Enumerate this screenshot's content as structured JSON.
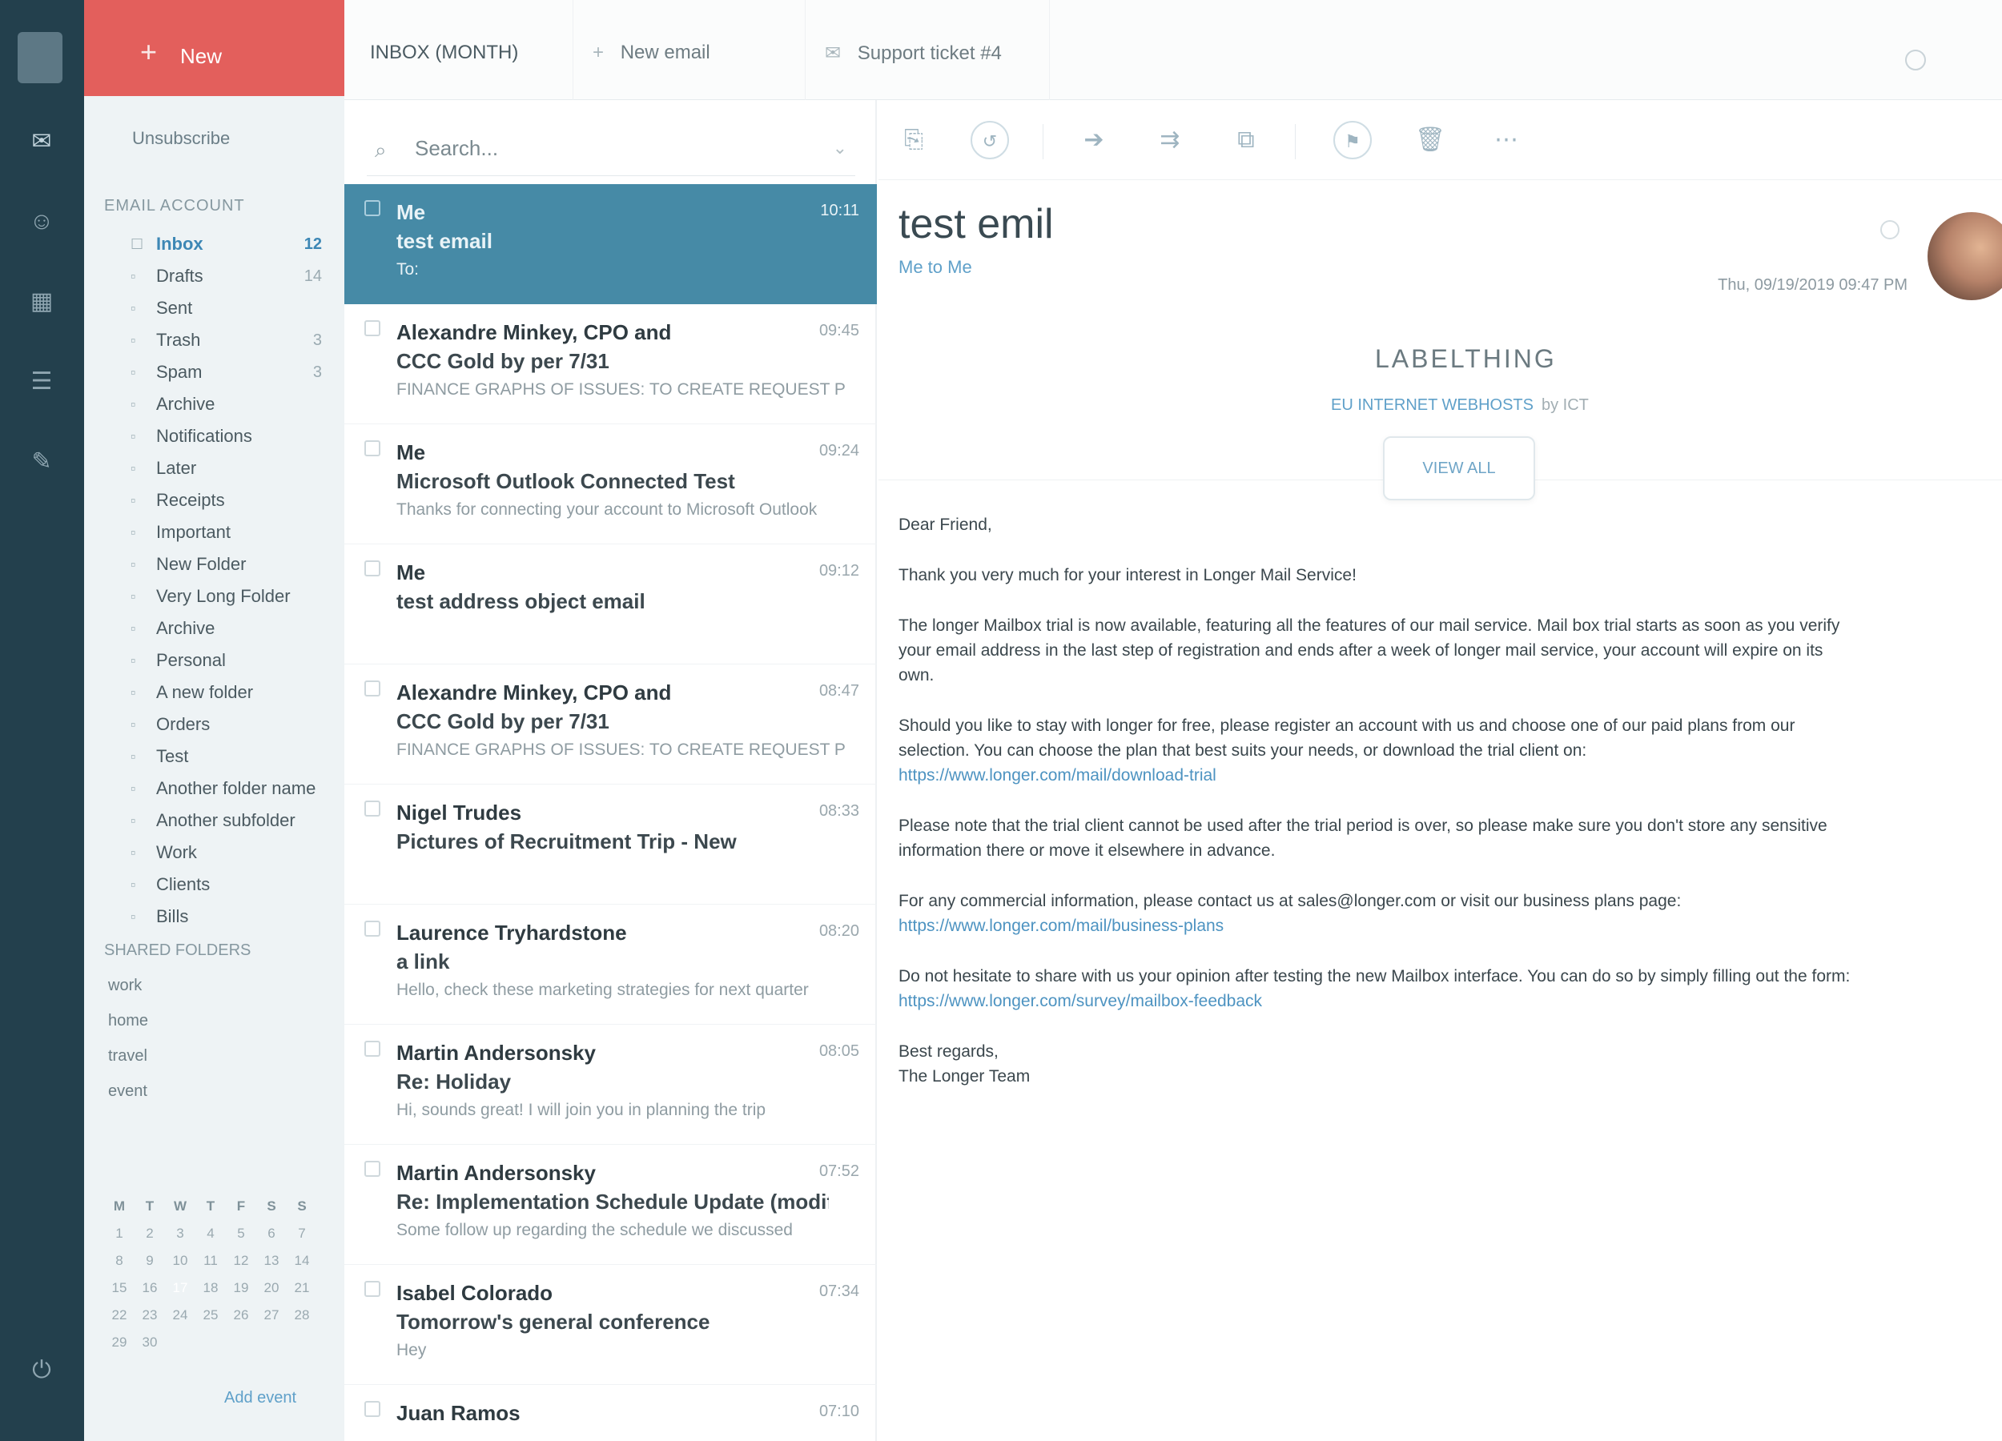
{
  "rail": {
    "icons": [
      "hamburger-icon",
      "mail-icon",
      "contacts-icon",
      "calendar-icon",
      "tasks-icon",
      "chat-icon",
      "logout-icon"
    ]
  },
  "compose": {
    "label": "New"
  },
  "folders_pane": {
    "unsubscribe": "Unsubscribe",
    "account": "EMAIL ACCOUNT",
    "folders": [
      {
        "label": "Inbox",
        "count": "12",
        "type": "inbox"
      },
      {
        "label": "Drafts",
        "count": "14",
        "type": "sub"
      },
      {
        "label": "Sent",
        "count": "",
        "type": "sub"
      },
      {
        "label": "Trash",
        "count": "3",
        "type": "sub"
      },
      {
        "label": "Spam",
        "count": "3",
        "type": "sub"
      },
      {
        "label": "Archive",
        "count": "",
        "type": "sub"
      },
      {
        "label": "Notifications",
        "count": "",
        "type": "sub"
      },
      {
        "label": "Later",
        "count": "",
        "type": "sub"
      },
      {
        "label": "Receipts",
        "count": "",
        "type": "sub"
      },
      {
        "label": "Important",
        "count": "",
        "type": "sub"
      },
      {
        "label": "New Folder",
        "count": "",
        "type": "sub"
      },
      {
        "label": "Very Long Folder",
        "count": "",
        "type": "sub"
      },
      {
        "label": "Archive",
        "count": "",
        "type": "sub"
      },
      {
        "label": "Personal",
        "count": "",
        "type": "sub"
      },
      {
        "label": "A new folder",
        "count": "",
        "type": "sub"
      },
      {
        "label": "Orders",
        "count": "",
        "type": "sub"
      },
      {
        "label": "Test",
        "count": "",
        "type": "sub"
      },
      {
        "label": "Another folder name",
        "count": "",
        "type": "sub"
      },
      {
        "label": "Another subfolder",
        "count": "",
        "type": "sub"
      },
      {
        "label": "Work",
        "count": "",
        "type": "sub"
      },
      {
        "label": "Clients",
        "count": "",
        "type": "sub"
      },
      {
        "label": "Bills",
        "count": "",
        "type": "sub"
      }
    ],
    "labels_title": "SHARED FOLDERS",
    "labels": [
      "work",
      "home",
      "travel",
      "event"
    ]
  },
  "calendar": {
    "weekdays": [
      "M",
      "T",
      "W",
      "T",
      "F",
      "S",
      "S"
    ],
    "weeks": [
      [
        "1",
        "2",
        "3",
        "4",
        "5",
        "6",
        "7"
      ],
      [
        "8",
        "9",
        "10",
        "11",
        "12",
        "13",
        "14"
      ],
      [
        "15",
        "16",
        "17",
        "18",
        "19",
        "20",
        "21"
      ],
      [
        "22",
        "23",
        "24",
        "25",
        "26",
        "27",
        "28"
      ],
      [
        "29",
        "30",
        "",
        "",
        "",
        "",
        ""
      ]
    ],
    "today": "17",
    "link": "Add event"
  },
  "tabs": [
    {
      "label": "INBOX (MONTH)",
      "icon": ""
    },
    {
      "label": "New email",
      "icon": "+"
    },
    {
      "label": "Support ticket #4",
      "icon": "✉"
    }
  ],
  "search": {
    "placeholder": "Search..."
  },
  "messages": [
    {
      "from": "Me",
      "date": "10:11",
      "subject": "test email",
      "preview": "To:",
      "selected": true
    },
    {
      "from": "Alexandre Minkey, CPO and",
      "date": "09:45",
      "subject": "CCC Gold by per 7/31",
      "preview": "FINANCE GRAPHS OF ISSUES: TO CREATE REQUEST PROMPT",
      "selected": false
    },
    {
      "from": "Me",
      "date": "09:24",
      "subject": "Microsoft Outlook Connected Test",
      "preview": "Thanks for connecting your account to Microsoft Outlook",
      "selected": false
    },
    {
      "from": "Me",
      "date": "09:12",
      "subject": "test address object email",
      "preview": "",
      "selected": false
    },
    {
      "from": "Alexandre Minkey, CPO and",
      "date": "08:47",
      "subject": "CCC Gold by per 7/31",
      "preview": "FINANCE GRAPHS OF ISSUES: TO CREATE REQUEST PROMPT",
      "selected": false
    },
    {
      "from": "Nigel Trudes",
      "date": "08:33",
      "subject": "Pictures of Recruitment Trip - New",
      "preview": "",
      "selected": false
    },
    {
      "from": "Laurence Tryhardstone",
      "date": "08:20",
      "subject": "a link",
      "preview": "Hello, check these marketing strategies for next quarter",
      "selected": false
    },
    {
      "from": "Martin Andersonsky",
      "date": "08:05",
      "subject": "Re: Holiday",
      "preview": "Hi, sounds great! I will join you in planning the trip",
      "selected": false
    },
    {
      "from": "Martin Andersonsky",
      "date": "07:52",
      "subject": "Re: Implementation Schedule Update (modified)",
      "preview": "Some follow up regarding the schedule we discussed",
      "selected": false
    },
    {
      "from": "Isabel Colorado",
      "date": "07:34",
      "subject": "Tomorrow's general conference",
      "preview": "Hey",
      "selected": false
    },
    {
      "from": "Juan Ramos",
      "date": "07:10",
      "subject": "",
      "preview": "",
      "selected": false
    }
  ],
  "toolbar": {
    "icons": [
      "reply-icon",
      "reply-all-icon",
      "forward-icon",
      "move-icon",
      "copy-icon",
      "archive-icon",
      "flag-icon",
      "delete-icon",
      "more-icon"
    ]
  },
  "email": {
    "subject": "test emil",
    "to": "Me to Me",
    "date": "Thu, 09/19/2019 09:47 PM",
    "banner_logo": "LABELTHING",
    "banner_sub": "EU INTERNET WEBHOSTS",
    "banner_sub_muted": "by ICT",
    "banner_btn": "VIEW ALL",
    "greeting": "Dear Friend,",
    "paragraphs": [
      "Thank you very much for your interest in Longer Mail Service!",
      "The longer Mailbox trial is now available, featuring all the features of our mail service. Mail box trial starts as soon as you verify your email address in the last step of registration and ends after a week of longer mail service, your account will expire on its own.",
      "Should you like to stay with longer for free, please register an account with us and choose one of our paid plans from our selection. You can choose the plan that best suits your needs, or download the trial client on:",
      "Please note that the trial client cannot be used after the trial period is over, so please make sure you don't store any sensitive information there or move it elsewhere in advance.",
      "For any commercial information, please contact us at sales@longer.com or visit our business plans page:",
      "Do not hesitate to share with us your opinion after testing the new Mailbox interface. You can do so by simply filling out the form:"
    ],
    "links": [
      "https://www.longer.com/mail/download-trial",
      "https://www.longer.com/mail/business-plans",
      "https://www.longer.com/survey/mailbox-feedback"
    ],
    "signoff": "Best regards,",
    "signature": "The Longer Team"
  }
}
